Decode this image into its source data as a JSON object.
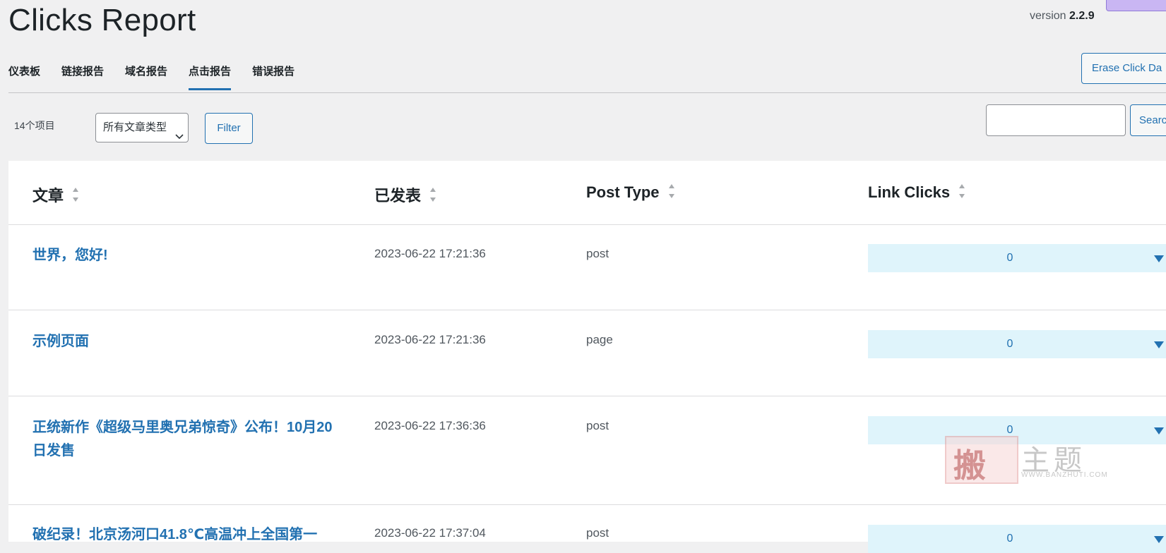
{
  "page": {
    "title": "Clicks Report",
    "version_label": "version",
    "version_number": "2.2.9"
  },
  "tabs": [
    {
      "label": "仪表板",
      "active": false
    },
    {
      "label": "链接报告",
      "active": false
    },
    {
      "label": "域名报告",
      "active": false
    },
    {
      "label": "点击报告",
      "active": true
    },
    {
      "label": "错误报告",
      "active": false
    }
  ],
  "toolbar": {
    "erase_label": "Erase Click Da",
    "items_count": "14个项目",
    "type_select_value": "所有文章类型",
    "filter_label": "Filter",
    "search_value": "",
    "search_label": "Searc"
  },
  "table": {
    "columns": [
      "文章",
      "已发表",
      "Post Type",
      "Link Clicks"
    ],
    "rows": [
      {
        "title": "世界，您好!",
        "published": "2023-06-22 17:21:36",
        "post_type": "post",
        "clicks": "0"
      },
      {
        "title": "示例页面",
        "published": "2023-06-22 17:21:36",
        "post_type": "page",
        "clicks": "0"
      },
      {
        "title": "正统新作《超级马里奥兄弟惊奇》公布！10月20日发售",
        "published": "2023-06-22 17:36:36",
        "post_type": "post",
        "clicks": "0"
      },
      {
        "title": "破纪录！北京汤河口41.8℃高温冲上全国第一",
        "published": "2023-06-22 17:37:04",
        "post_type": "post",
        "clicks": "0"
      }
    ]
  },
  "watermark": {
    "glyph": "搬",
    "text": "主题",
    "url": "WWW.BANZHUTI.COM"
  },
  "colors": {
    "accent": "#2271b1",
    "clicks_bg": "#dff4fb",
    "page_bg": "#f0f0f1"
  }
}
